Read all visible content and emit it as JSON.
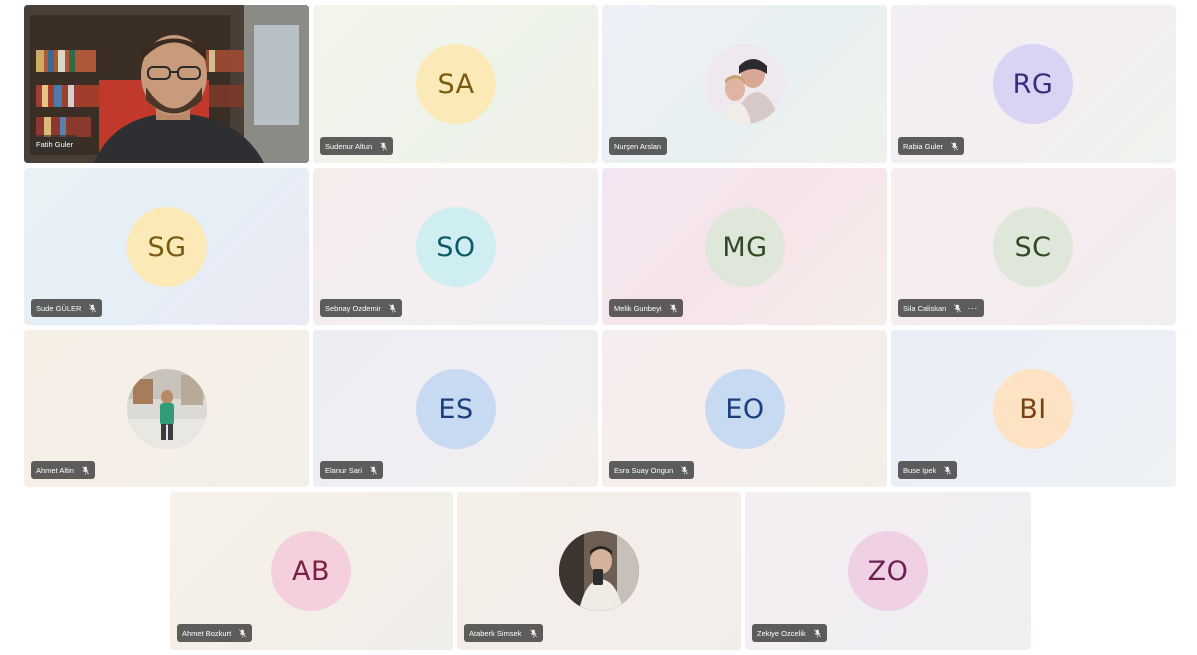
{
  "participants": [
    {
      "name": "Fatih Guler",
      "video": true
    },
    {
      "name": "Sudenur Altun",
      "initials": "SA",
      "avatar_bg": "#fbe9b8",
      "avatar_fg": "#7a5a10"
    },
    {
      "name": "Nurşen Arslan",
      "photo": true
    },
    {
      "name": "Rabia Guler",
      "initials": "RG",
      "avatar_bg": "#d9d4f4",
      "avatar_fg": "#3a2d7a"
    },
    {
      "name": "Sude GÜLER",
      "initials": "SG",
      "avatar_bg": "#fbe9b8",
      "avatar_fg": "#7a5a10"
    },
    {
      "name": "Sebnay Ozdemir",
      "initials": "SO",
      "avatar_bg": "#cfeef2",
      "avatar_fg": "#0f5a66"
    },
    {
      "name": "Melik Gunbeyi",
      "initials": "MG",
      "avatar_bg": "#dfe6da",
      "avatar_fg": "#2f4b23"
    },
    {
      "name": "Sila Caliskan",
      "initials": "SC",
      "avatar_bg": "#dfe6da",
      "avatar_fg": "#2f4b23",
      "more": "···"
    },
    {
      "name": "Ahmet Altin",
      "photo": true
    },
    {
      "name": "Elanur Sari",
      "initials": "ES",
      "avatar_bg": "#c8d9f2",
      "avatar_fg": "#1a3f7a"
    },
    {
      "name": "Esra Suay Ongun",
      "initials": "EO",
      "avatar_bg": "#c8d9f2",
      "avatar_fg": "#1a3f7a"
    },
    {
      "name": "Buse Ipek",
      "initials": "BI",
      "avatar_bg": "#fde3c4",
      "avatar_fg": "#7a4210"
    },
    {
      "name": "Ahmet Bozkurt",
      "initials": "AB",
      "avatar_bg": "#f4cfdc",
      "avatar_fg": "#7a1f45"
    },
    {
      "name": "Ataberk Simsek",
      "photo": true
    },
    {
      "name": "Zekiye Ozcelik",
      "initials": "ZO",
      "avatar_bg": "#f0d0e4",
      "avatar_fg": "#6a1f52"
    }
  ]
}
